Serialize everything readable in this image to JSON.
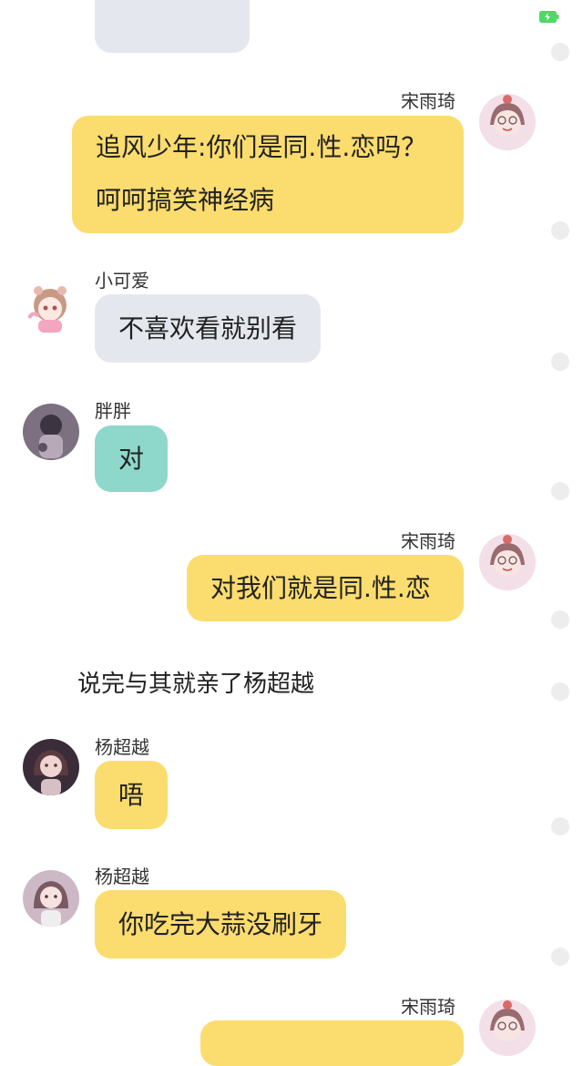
{
  "status": {
    "battery_icon": "battery-charging-icon"
  },
  "messages": [
    {
      "sender": "宋雨琦",
      "side": "right",
      "color": "#fbdc6e",
      "lines": [
        "追风少年:你们是同.性.恋吗？",
        "呵呵搞笑神经病"
      ]
    },
    {
      "sender": "小可爱",
      "side": "left",
      "color": "#e4e8ee",
      "text": "不喜欢看就别看"
    },
    {
      "sender": "胖胖",
      "side": "left",
      "color": "#8ed8cb",
      "text": "对"
    },
    {
      "sender": "宋雨琦",
      "side": "right",
      "color": "#fbdc6e",
      "text": "对我们就是同.性.恋"
    },
    {
      "sender": "杨超越",
      "side": "left",
      "color": "#fbdc6e",
      "text": "唔"
    },
    {
      "sender": "杨超越",
      "side": "left",
      "color": "#fbdc6e",
      "text": "你吃完大蒜没刷牙"
    },
    {
      "sender": "宋雨琦",
      "side": "right",
      "color": "#fbdc6e",
      "text": ""
    }
  ],
  "narration": "说完与其就亲了杨超越"
}
